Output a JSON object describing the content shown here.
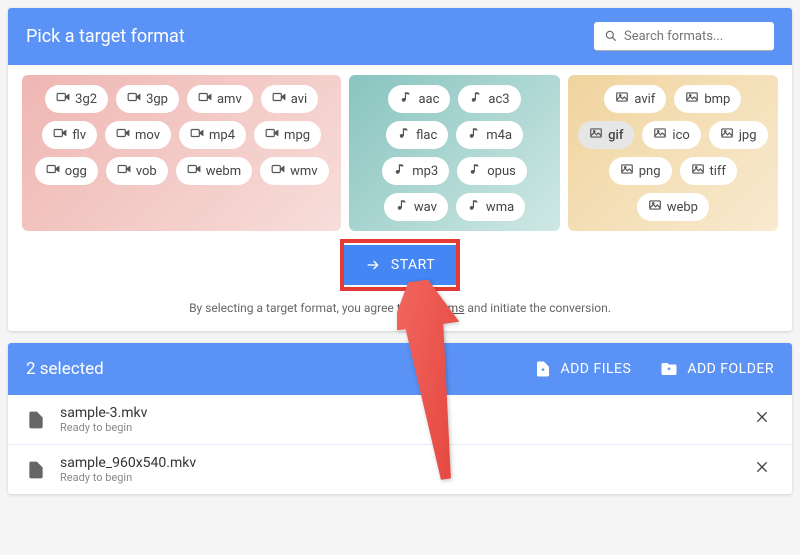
{
  "header": {
    "title": "Pick a target format"
  },
  "search": {
    "placeholder": "Search formats..."
  },
  "formats": {
    "video": [
      "3g2",
      "3gp",
      "amv",
      "avi",
      "flv",
      "mov",
      "mp4",
      "mpg",
      "ogg",
      "vob",
      "webm",
      "wmv"
    ],
    "audio": [
      "aac",
      "ac3",
      "flac",
      "m4a",
      "mp3",
      "opus",
      "wav",
      "wma"
    ],
    "image": [
      "avif",
      "bmp",
      "gif",
      "ico",
      "jpg",
      "png",
      "tiff",
      "webp"
    ]
  },
  "selected_format": "gif",
  "start": {
    "label": "START"
  },
  "terms": {
    "prefix": "By selecting a target format, you agree to our ",
    "link": "Terms",
    "suffix": " and initiate the conversion."
  },
  "selection": {
    "count_label": "2 selected",
    "add_files_label": "ADD FILES",
    "add_folder_label": "ADD FOLDER"
  },
  "files": [
    {
      "name": "sample-3.mkv",
      "status": "Ready to begin"
    },
    {
      "name": "sample_960x540.mkv",
      "status": "Ready to begin"
    }
  ]
}
